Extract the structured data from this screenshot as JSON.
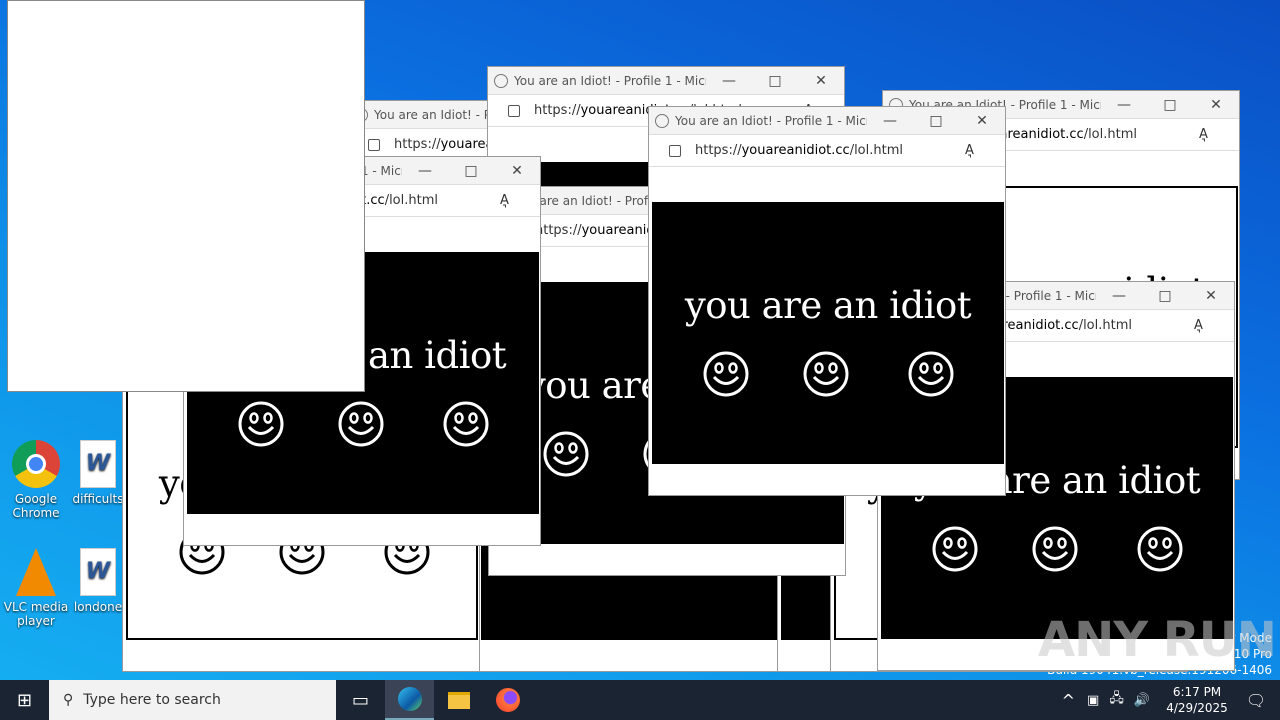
{
  "browser": {
    "title": "You are an Idiot! - Profile 1 - Micro...",
    "url_scheme": "https://",
    "url_domain": "youareanidiot.cc",
    "url_path": "/lol.html",
    "caption": "you are an idiot",
    "read_aloud": "A͉",
    "minimize": "—",
    "maximize": "□",
    "close": "✕"
  },
  "desktop": {
    "icons": [
      {
        "label": "Google Chrome"
      },
      {
        "label": "difficults"
      },
      {
        "label": "VLC media player"
      },
      {
        "label": "londone"
      }
    ]
  },
  "taskbar": {
    "search_placeholder": "Type here to search",
    "time": "6:17 PM",
    "date": "4/29/2025"
  },
  "watermark": {
    "line1": "Test Mode",
    "line2": "Windows 10 Pro",
    "line3": "Build 19041.vb_release.191206-1406",
    "brand": "ANY RUN"
  },
  "colors": {
    "desktop": "#0b6fe0",
    "taskbar": "#1b2433",
    "page_bg": "#000000",
    "page_fg": "#ffffff"
  }
}
